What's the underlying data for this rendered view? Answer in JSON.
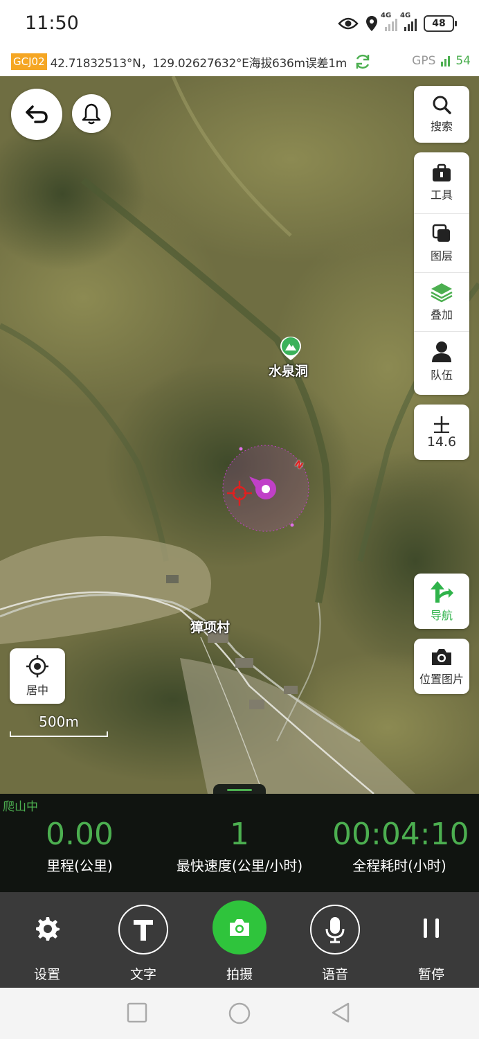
{
  "status": {
    "time": "11:50",
    "net1": "4G",
    "net2": "4G",
    "battery": "48"
  },
  "location": {
    "system": "GCJ02",
    "readout": "42.71832513°N，129.02627632°E海拔636m误差1m",
    "gps_label": "GPS",
    "gps_count": "54"
  },
  "map": {
    "places": [
      "水泉洞",
      "獐项村"
    ],
    "heading_marker": "N",
    "scale_label": "500m",
    "zoom_level": "14.6"
  },
  "side_panel": {
    "search": "搜索",
    "tools": "工具",
    "layers": "图层",
    "overlay": "叠加",
    "team": "队伍",
    "navigate": "导航",
    "location_photo": "位置图片"
  },
  "center_button": "居中",
  "stats": {
    "mode": "爬山中",
    "distance": {
      "value": "0.00",
      "label": "里程(公里)"
    },
    "max_speed": {
      "value": "1",
      "label": "最快速度(公里/小时)"
    },
    "duration": {
      "value": "00:04:10",
      "label": "全程耗时(小时)"
    }
  },
  "toolbar": [
    {
      "label": "设置",
      "icon": "gear-icon"
    },
    {
      "label": "文字",
      "icon": "text-icon"
    },
    {
      "label": "拍摄",
      "icon": "camera-icon"
    },
    {
      "label": "语音",
      "icon": "microphone-icon"
    },
    {
      "label": "暂停",
      "icon": "pause-icon"
    }
  ],
  "colors": {
    "accent_green": "#4caf50",
    "gcj_badge": "#f5a623",
    "location_marker": "#c040c8",
    "stats_bg": "#101410",
    "toolbar_bg": "#3a3a3a"
  }
}
